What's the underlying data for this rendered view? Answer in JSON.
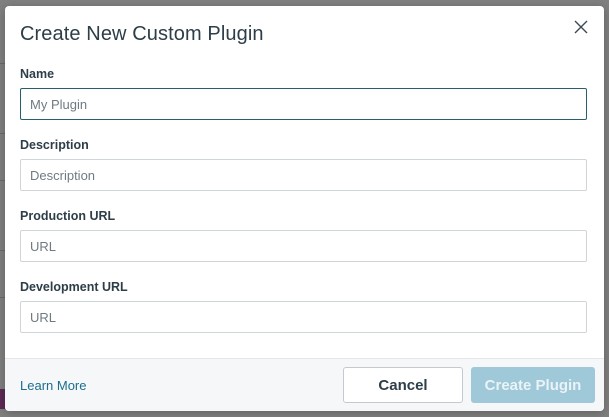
{
  "modal": {
    "title": "Create New Custom Plugin",
    "close_icon": "close-icon"
  },
  "form": {
    "name": {
      "label": "Name",
      "placeholder": "My Plugin",
      "value": ""
    },
    "description": {
      "label": "Description",
      "placeholder": "Description",
      "value": ""
    },
    "production_url": {
      "label": "Production URL",
      "placeholder": "URL",
      "value": ""
    },
    "development_url": {
      "label": "Development URL",
      "placeholder": "URL",
      "value": ""
    }
  },
  "footer": {
    "learn_more": "Learn More",
    "cancel_label": "Cancel",
    "create_label": "Create Plugin"
  },
  "colors": {
    "title_text": "#2d3e48",
    "link": "#1c6e8e",
    "focus_border": "#27606d",
    "primary_disabled": "#9fc8d8"
  }
}
